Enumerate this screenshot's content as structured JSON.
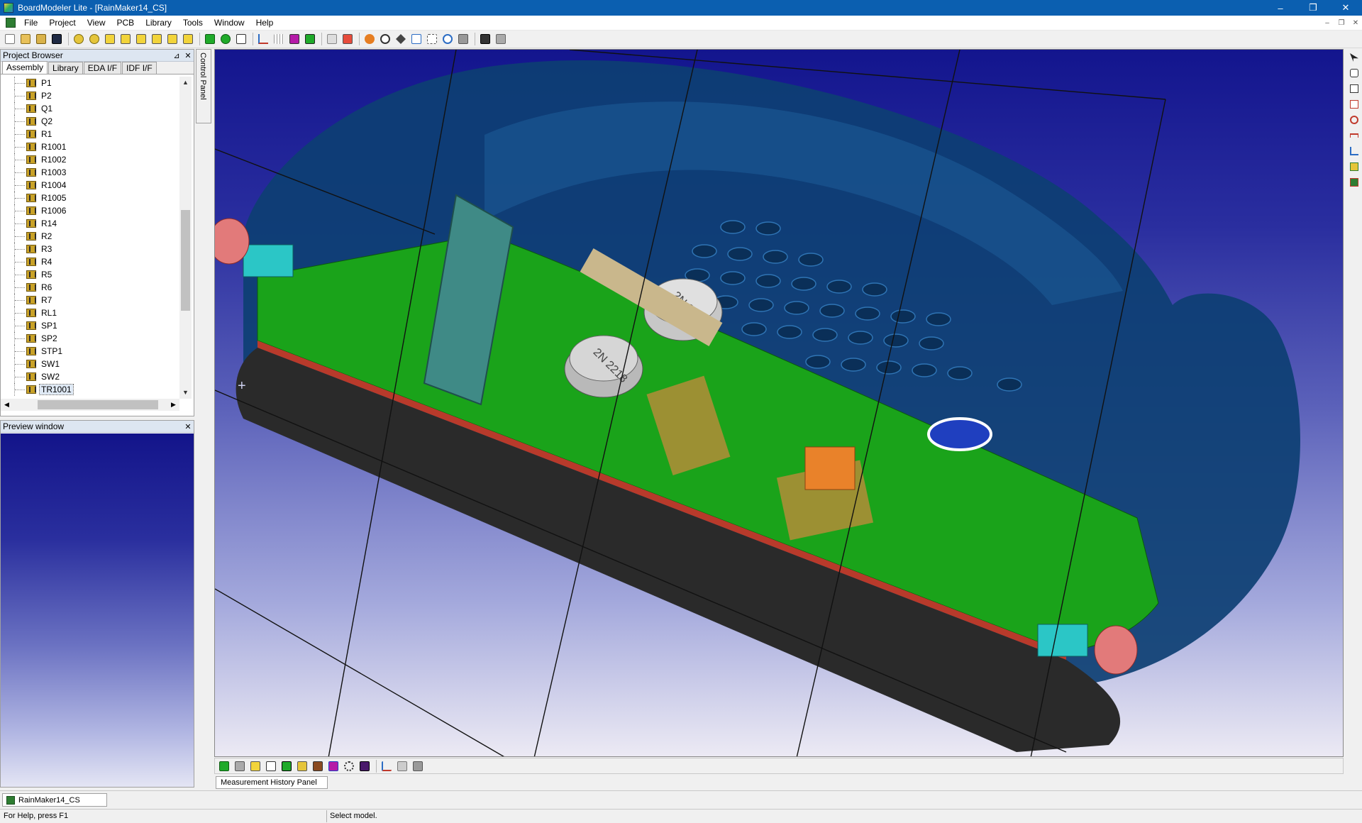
{
  "window": {
    "title": "BoardModeler Lite - [RainMaker14_CS]",
    "minimize": "–",
    "restore": "❐",
    "close": "✕"
  },
  "menu": {
    "items": [
      "File",
      "Project",
      "View",
      "PCB",
      "Library",
      "Tools",
      "Window",
      "Help"
    ]
  },
  "project_browser": {
    "title": "Project Browser",
    "pin": "📌",
    "close": "✕",
    "tabs": [
      "Assembly",
      "Library",
      "EDA I/F",
      "IDF I/F"
    ],
    "active_tab": "Assembly",
    "items": [
      "P1",
      "P2",
      "Q1",
      "Q2",
      "R1",
      "R1001",
      "R1002",
      "R1003",
      "R1004",
      "R1005",
      "R1006",
      "R14",
      "R2",
      "R3",
      "R4",
      "R5",
      "R6",
      "R7",
      "RL1",
      "SP1",
      "SP2",
      "STP1",
      "SW1",
      "SW2",
      "TR1001"
    ],
    "selected_item": "TR1001"
  },
  "control_panel": {
    "label": "Control Panel"
  },
  "preview": {
    "title": "Preview window",
    "close": "✕"
  },
  "viewport": {
    "cursor_glyph": "+",
    "component_marking_1": "2N 2218",
    "component_marking_2": "2N 2218"
  },
  "measurement_panel": {
    "tab_label": "Measurement History Panel"
  },
  "document_tab": {
    "label": "RainMaker14_CS"
  },
  "status": {
    "help_text": "For Help, press F1",
    "message": "Select model."
  },
  "colors": {
    "titlebar": "#0b5fb0",
    "pcb_green": "#1aa31a",
    "housing_blue": "#0d3f73",
    "board_red": "#b83a2b"
  }
}
